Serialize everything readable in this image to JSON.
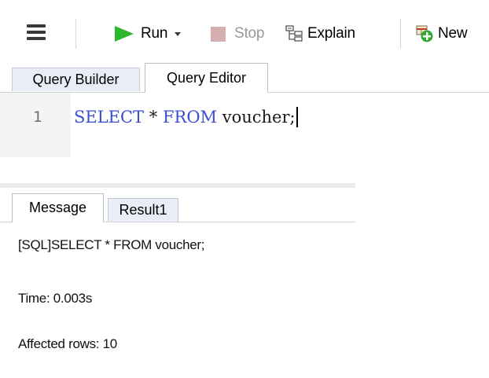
{
  "toolbar": {
    "run_label": "Run",
    "stop_label": "Stop",
    "explain_label": "Explain",
    "new_label": "New",
    "run_color": "#2db72d",
    "stop_color": "#d7aeb0"
  },
  "editor_tabs": {
    "builder_label": "Query Builder",
    "editor_label": "Query Editor",
    "active": "Query Editor"
  },
  "editor": {
    "line_number": "1",
    "tokens": {
      "select": "SELECT",
      "star": " * ",
      "from": "FROM",
      "rest": " voucher;"
    },
    "keyword_color": "#3a4fd6"
  },
  "result_tabs": {
    "message_label": "Message",
    "result_label": "Result1",
    "active": "Message"
  },
  "messages": {
    "sql": "[SQL]SELECT * FROM voucher;",
    "time": "Time: 0.003s",
    "affected": "Affected rows: 10"
  }
}
